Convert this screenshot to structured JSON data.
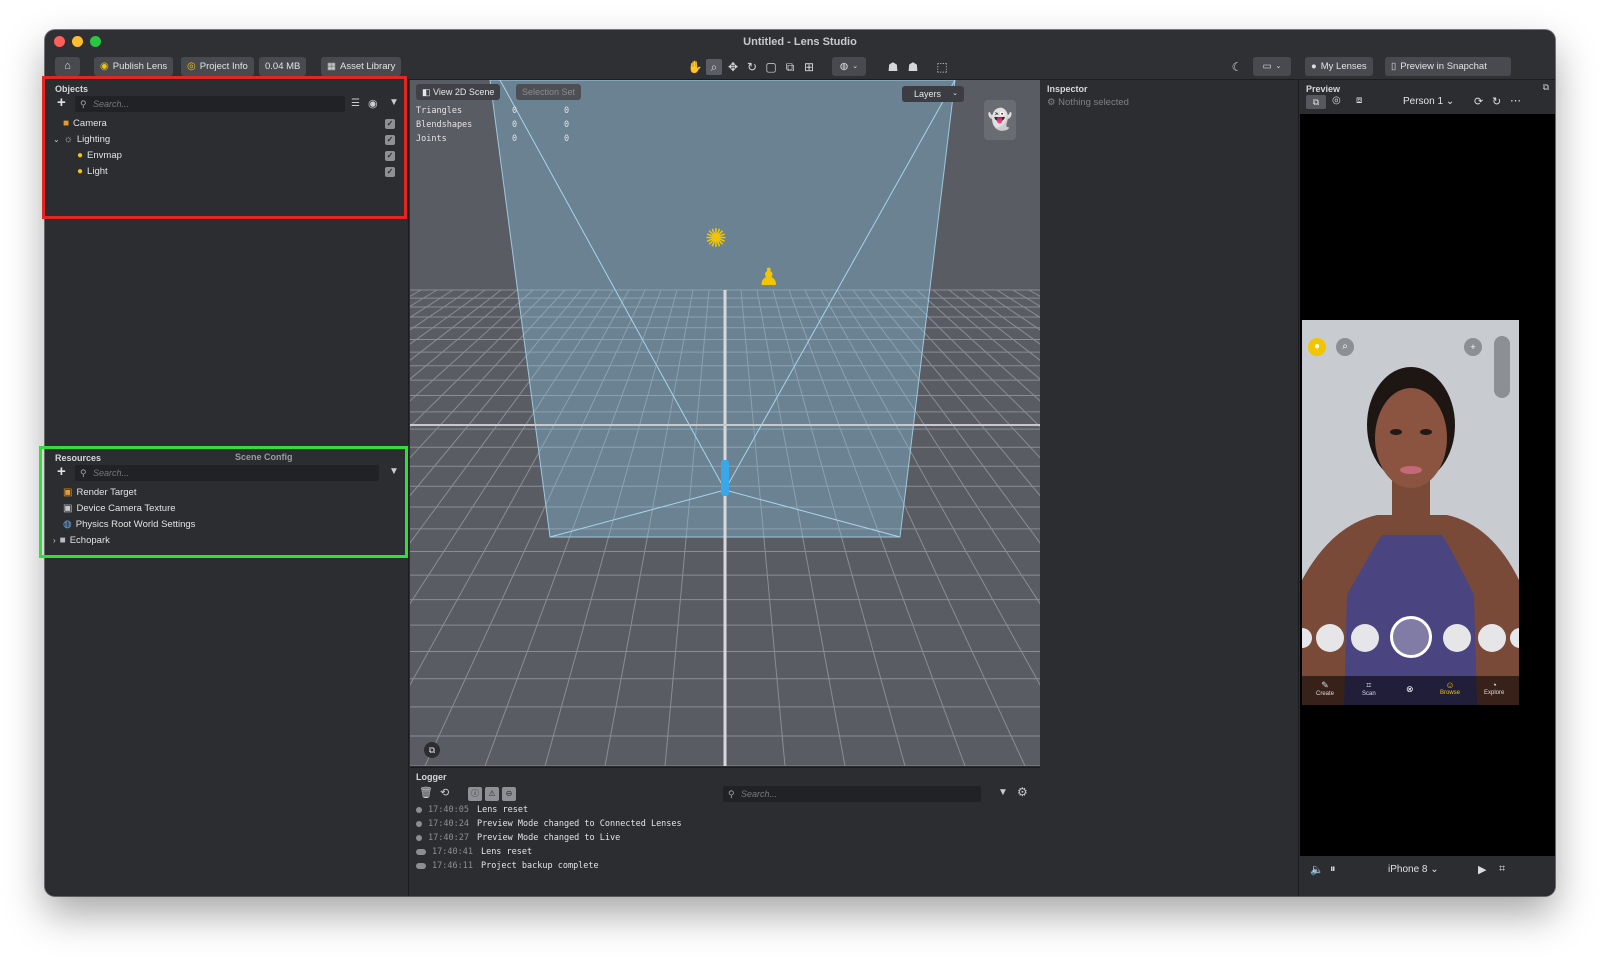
{
  "window": {
    "title": "Untitled - Lens Studio"
  },
  "toolbar": {
    "home_icon": "home-icon",
    "publish_label": "Publish Lens",
    "project_info_label": "Project Info",
    "size_label": "0.04 MB",
    "asset_library_label": "Asset Library",
    "my_lenses_label": "My Lenses",
    "preview_snapchat_label": "Preview in Snapchat"
  },
  "objects": {
    "header": "Objects",
    "search_placeholder": "Search...",
    "items": [
      {
        "label": "Camera",
        "icon": "camera-icon"
      },
      {
        "label": "Lighting",
        "icon": "lighting-group-icon"
      },
      {
        "label": "Envmap",
        "icon": "bulb-icon"
      },
      {
        "label": "Light",
        "icon": "bulb-icon"
      }
    ]
  },
  "resources": {
    "header": "Resources",
    "tab_scene_config": "Scene Config",
    "search_placeholder": "Search...",
    "items": [
      {
        "label": "Render Target"
      },
      {
        "label": "Device Camera Texture"
      },
      {
        "label": "Physics Root World Settings"
      },
      {
        "label": "Echopark"
      }
    ]
  },
  "viewport": {
    "view_label": "View 2D Scene",
    "selection_set_label": "Selection Set",
    "layers_label": "Layers",
    "stats": [
      {
        "name": "Triangles",
        "v1": "0",
        "v2": "0"
      },
      {
        "name": "Blendshapes",
        "v1": "0",
        "v2": "0"
      },
      {
        "name": "Joints",
        "v1": "0",
        "v2": "0"
      }
    ]
  },
  "logger": {
    "header": "Logger",
    "search_placeholder": "Search...",
    "lines": [
      {
        "time": "17:40:05",
        "msg": "Lens reset"
      },
      {
        "time": "17:40:24",
        "msg": "Preview Mode changed to Connected Lenses"
      },
      {
        "time": "17:40:27",
        "msg": "Preview Mode changed to Live"
      },
      {
        "time": "17:40:41",
        "msg": "Lens reset"
      },
      {
        "time": "17:46:11",
        "msg": "Project backup complete"
      }
    ]
  },
  "inspector": {
    "header": "Inspector",
    "empty_label": "Nothing selected"
  },
  "preview": {
    "header": "Preview",
    "person_label": "Person 1",
    "device_label": "iPhone 8",
    "nav": [
      "Create",
      "Scan",
      "Browse",
      "Explore"
    ]
  },
  "colors": {
    "accent_yellow": "#f2c500",
    "highlight_red": "#e52521",
    "highlight_green": "#2fe03a"
  }
}
